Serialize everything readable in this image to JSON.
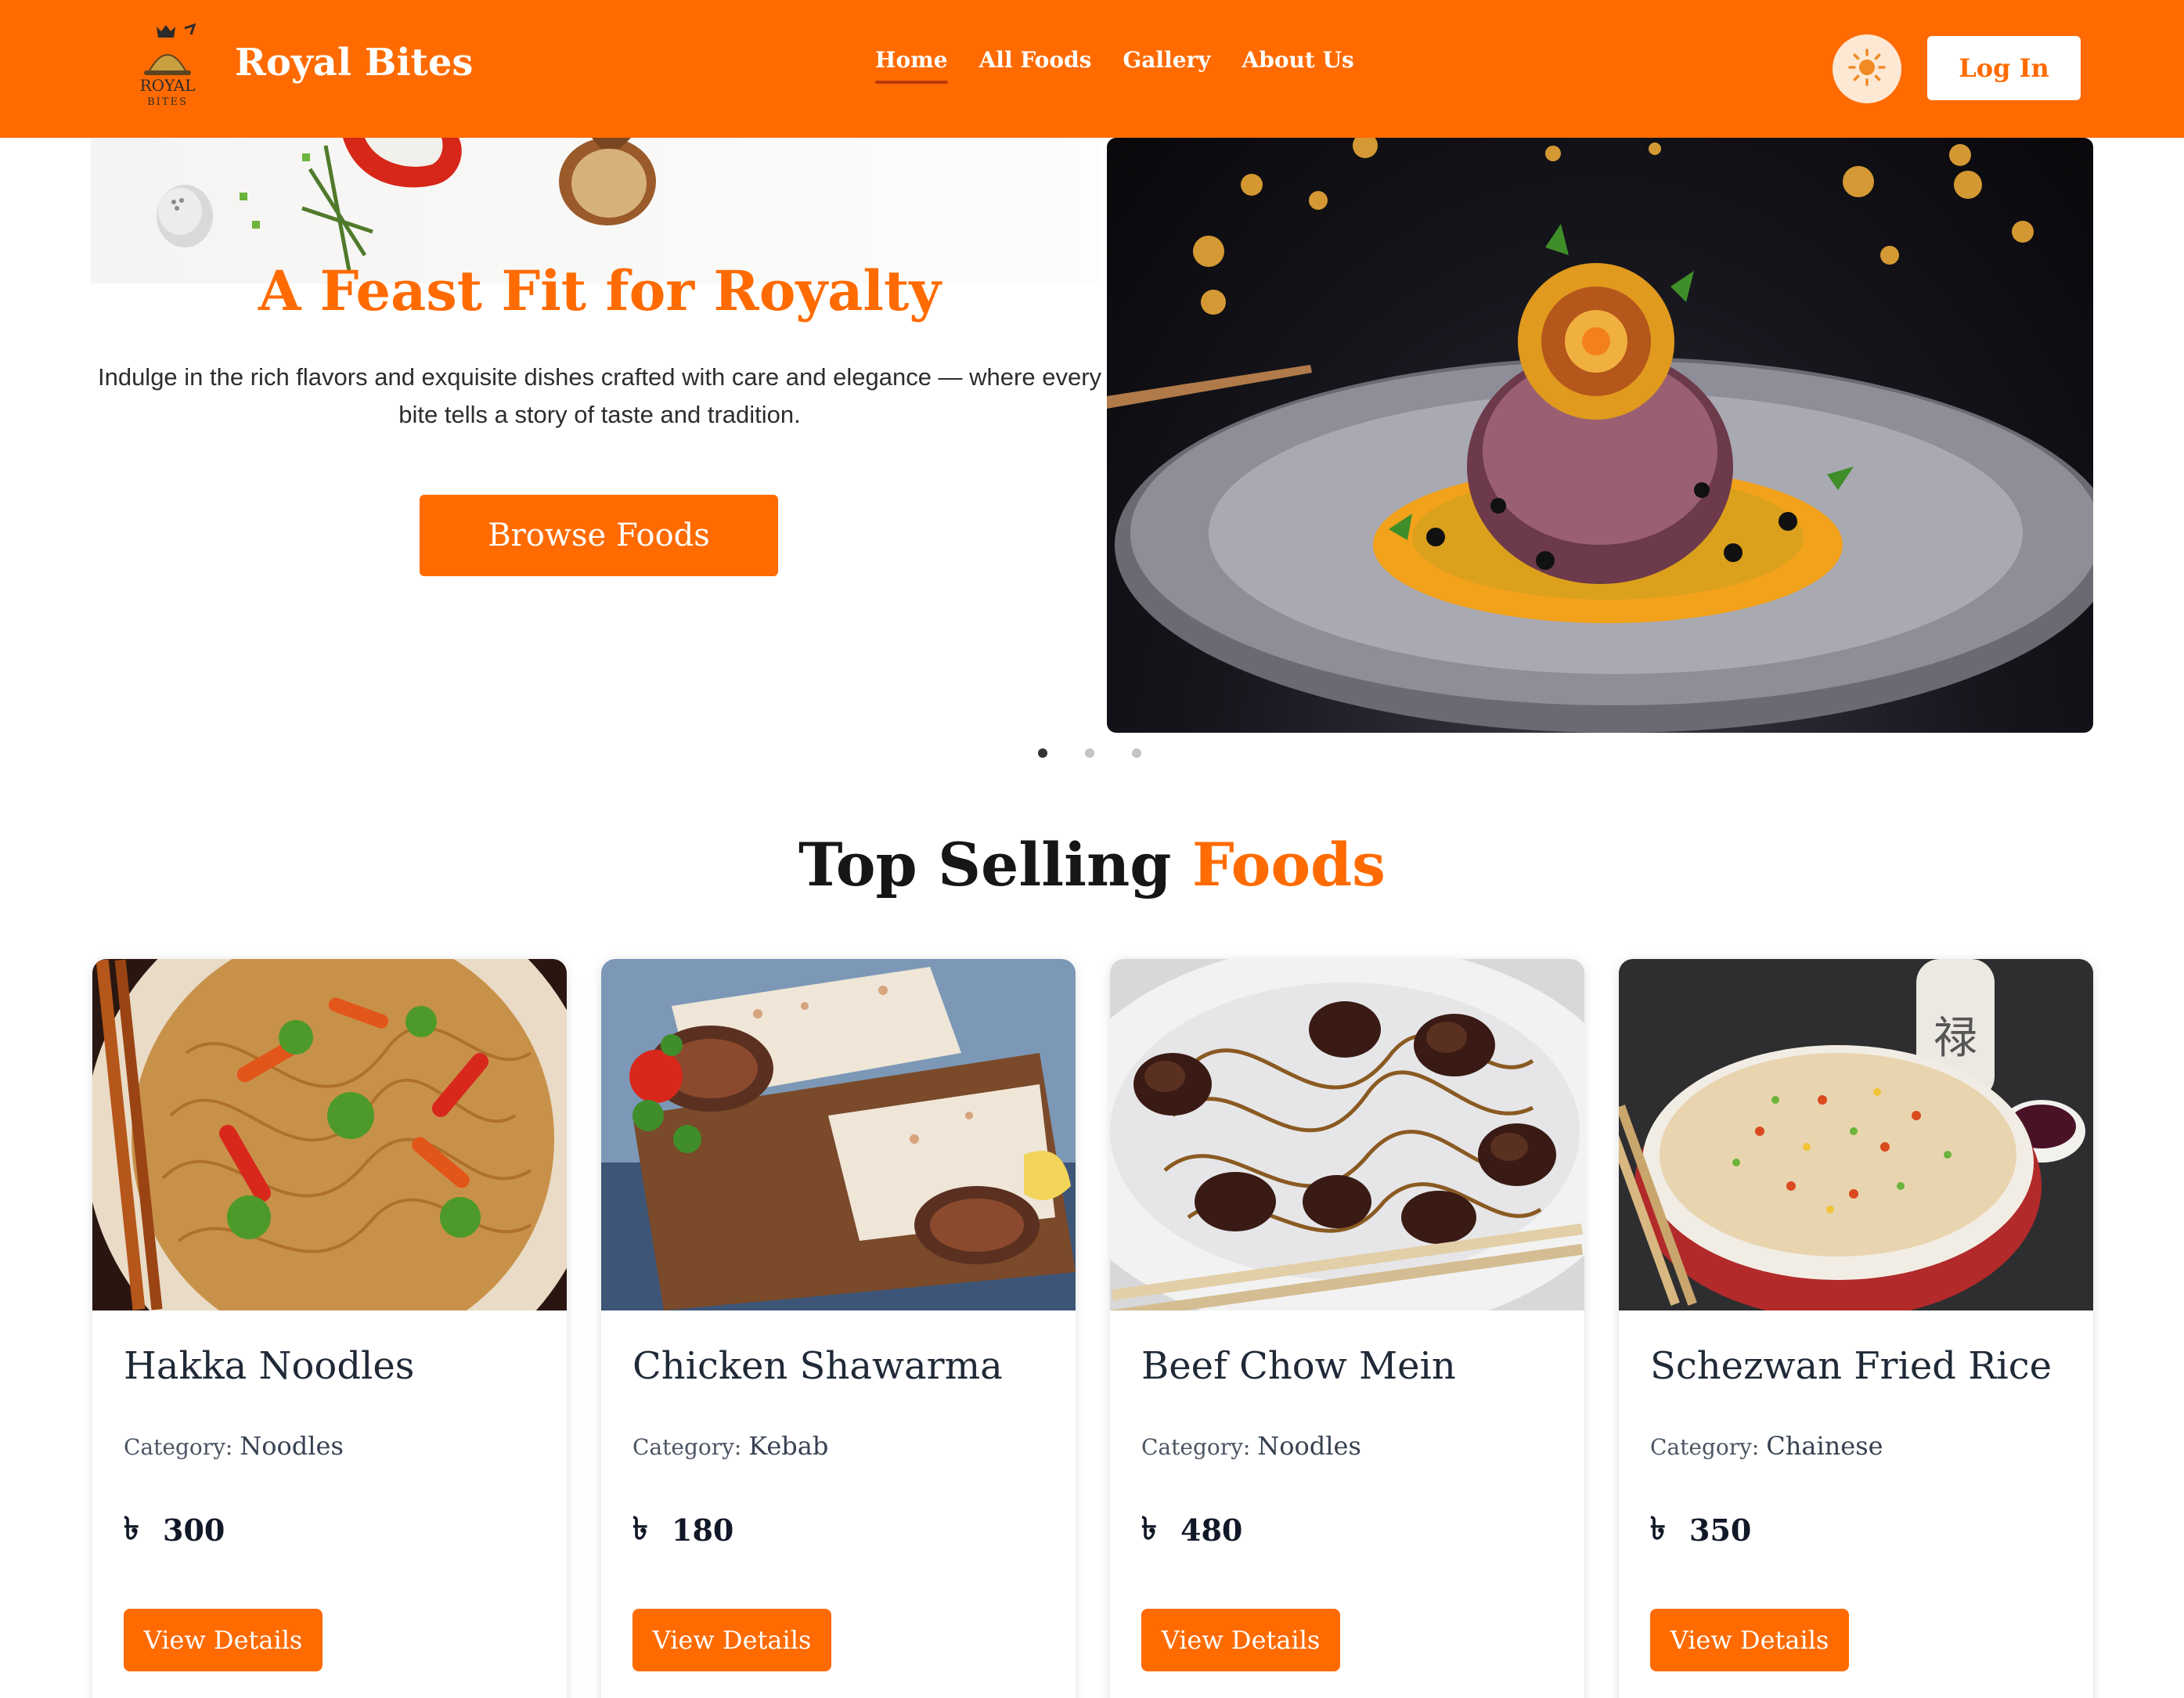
{
  "brand": {
    "logo_top": "ROYAL",
    "logo_bottom": "BITES",
    "name": "Royal Bites",
    "accent_color": "#ff6b00"
  },
  "nav": {
    "items": [
      {
        "label": "Home",
        "active": true
      },
      {
        "label": "All Foods",
        "active": false
      },
      {
        "label": "Gallery",
        "active": false
      },
      {
        "label": "About Us",
        "active": false
      }
    ],
    "theme_icon": "sun-icon",
    "login_label": "Log In"
  },
  "hero": {
    "title": "A Feast Fit for Royalty",
    "description": "Indulge in the rich flavors and exquisite dishes crafted with care and elegance — where every bite tells a story of taste and tradition.",
    "button_label": "Browse Foods",
    "slide_count": 3,
    "active_slide": 1
  },
  "section": {
    "title_plain": "Top Selling ",
    "title_accent": "Foods"
  },
  "foods": [
    {
      "name": "Hakka Noodles",
      "category_label": "Category:",
      "category": "Noodles",
      "currency_icon": "৳",
      "price": "300",
      "button": "View Details"
    },
    {
      "name": "Chicken Shawarma",
      "category_label": "Category:",
      "category": "Kebab",
      "currency_icon": "৳",
      "price": "180",
      "button": "View Details"
    },
    {
      "name": "Beef Chow Mein",
      "category_label": "Category:",
      "category": "Noodles",
      "currency_icon": "৳",
      "price": "480",
      "button": "View Details"
    },
    {
      "name": "Schezwan Fried Rice",
      "category_label": "Category:",
      "category": "Chainese",
      "currency_icon": "৳",
      "price": "350",
      "button": "View Details"
    }
  ]
}
